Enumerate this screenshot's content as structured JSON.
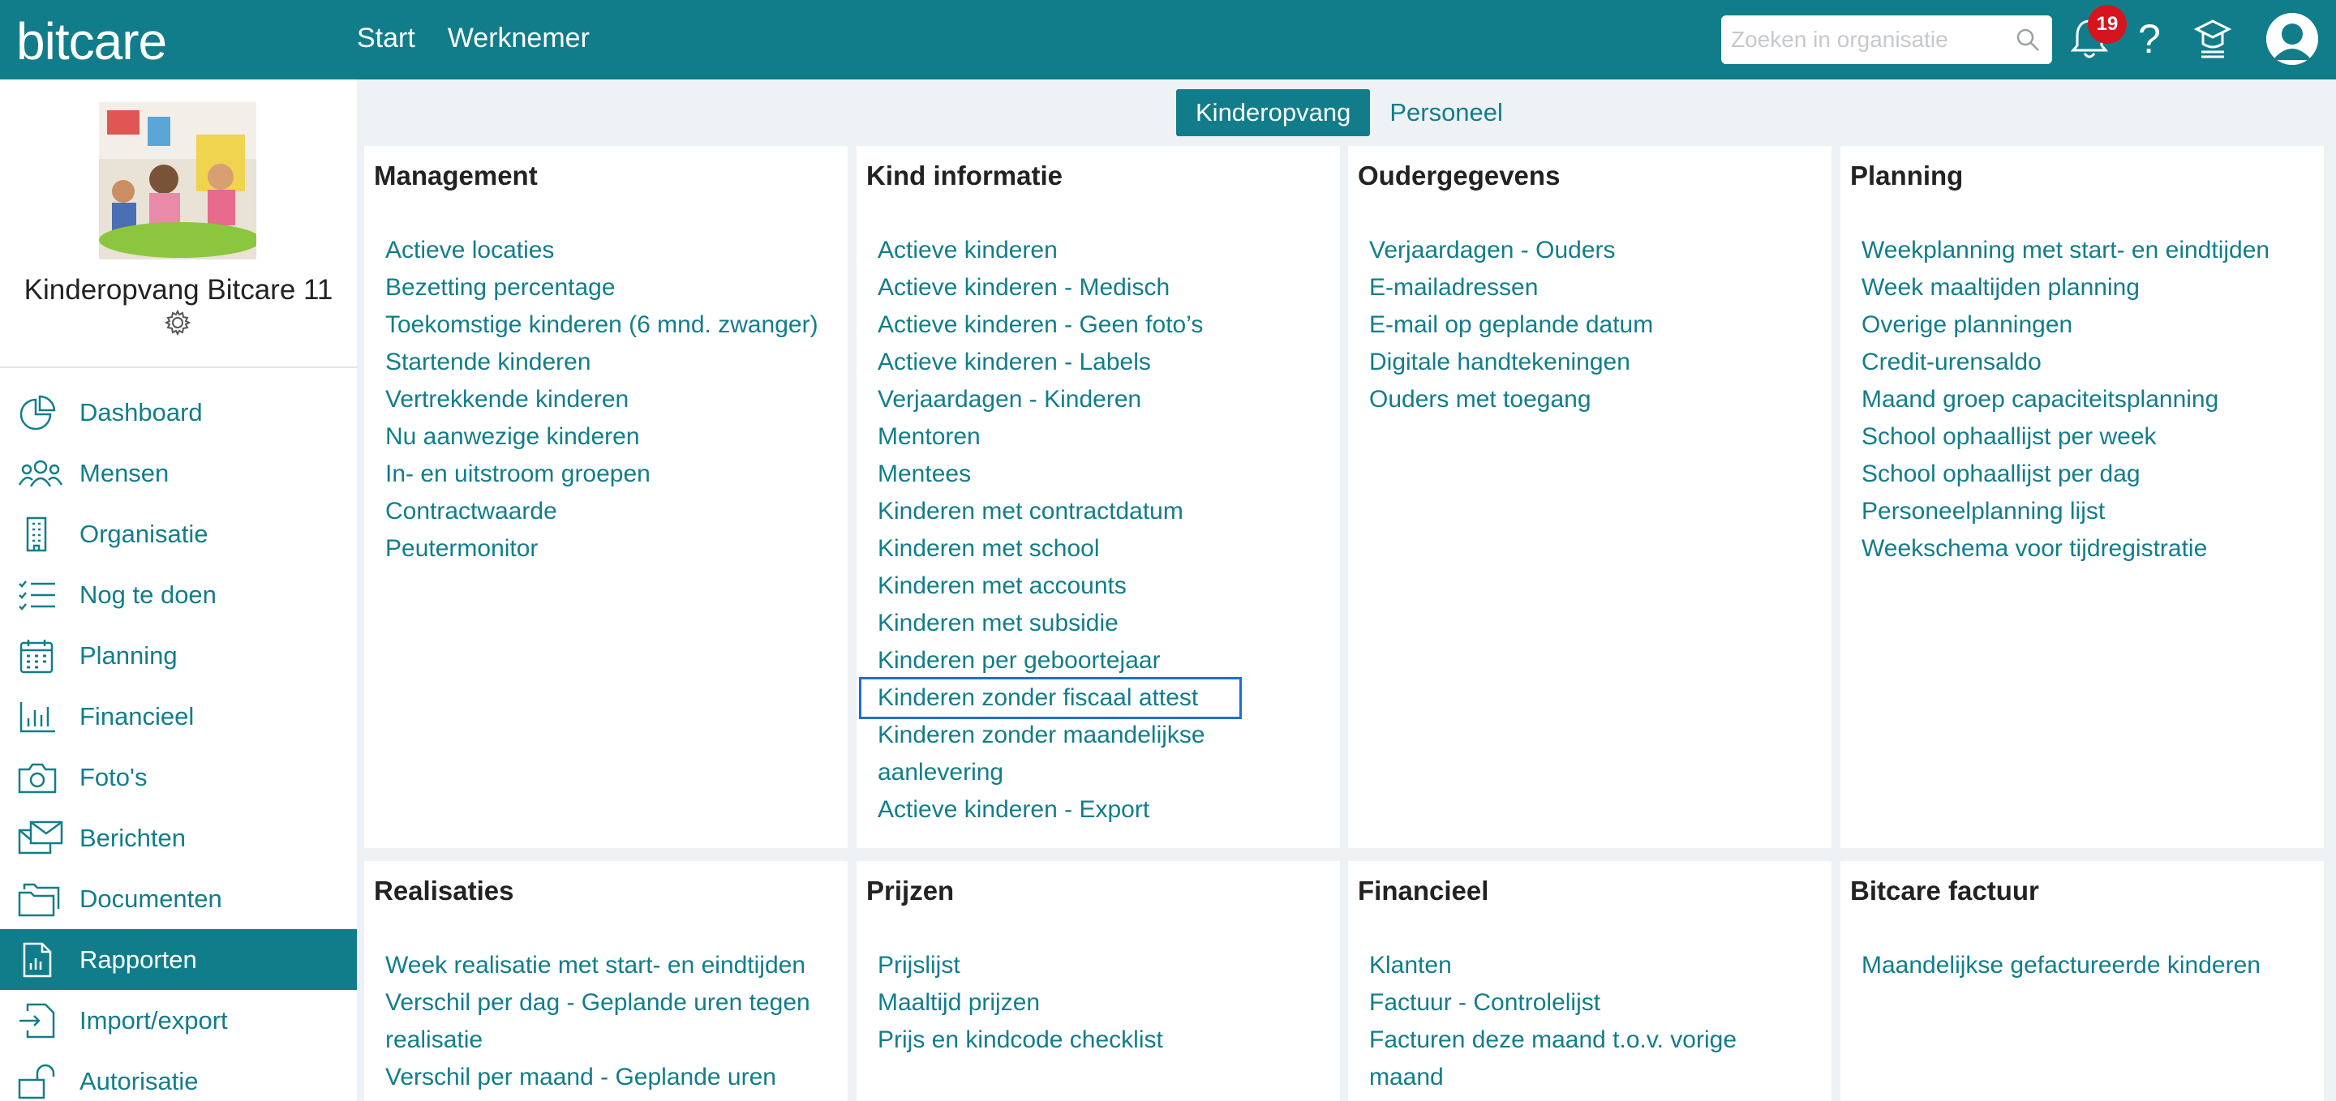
{
  "app": {
    "logo": "bitcare"
  },
  "topnav": {
    "start": "Start",
    "werknemer": "Werknemer"
  },
  "search": {
    "placeholder": "Zoeken in organisatie"
  },
  "notifications": {
    "count": "19"
  },
  "help": {
    "label": "?"
  },
  "sidebar": {
    "org_name": "Kinderopvang Bitcare 11",
    "items": [
      {
        "label": "Dashboard",
        "icon": "pie-chart-icon"
      },
      {
        "label": "Mensen",
        "icon": "people-icon"
      },
      {
        "label": "Organisatie",
        "icon": "building-icon"
      },
      {
        "label": "Nog te doen",
        "icon": "checklist-icon"
      },
      {
        "label": "Planning",
        "icon": "calendar-icon"
      },
      {
        "label": "Financieel",
        "icon": "bar-chart-icon"
      },
      {
        "label": "Foto's",
        "icon": "camera-icon"
      },
      {
        "label": "Berichten",
        "icon": "messages-icon"
      },
      {
        "label": "Documenten",
        "icon": "folder-icon"
      },
      {
        "label": "Rapporten",
        "icon": "report-icon",
        "active": true
      },
      {
        "label": "Import/export",
        "icon": "import-export-icon"
      },
      {
        "label": "Autorisatie",
        "icon": "lock-icon"
      }
    ]
  },
  "tabs": {
    "kinderopvang": "Kinderopvang",
    "personeel": "Personeel"
  },
  "cards": {
    "management": {
      "title": "Management",
      "links": [
        "Actieve locaties",
        "Bezetting percentage",
        "Toekomstige kinderen (6 mnd. zwanger)",
        "Startende kinderen",
        "Vertrekkende kinderen",
        "Nu aanwezige kinderen",
        "In- en uitstroom groepen",
        "Contractwaarde",
        "Peutermonitor"
      ]
    },
    "kind_informatie": {
      "title": "Kind informatie",
      "links": [
        "Actieve kinderen",
        "Actieve kinderen - Medisch",
        "Actieve kinderen - Geen foto’s",
        "Actieve kinderen - Labels",
        "Verjaardagen - Kinderen",
        "Mentoren",
        "Mentees",
        "Kinderen met contractdatum",
        "Kinderen met school",
        "Kinderen met accounts",
        "Kinderen met subsidie",
        "Kinderen per geboortejaar",
        "Kinderen zonder fiscaal attest",
        "Kinderen zonder maandelijkse aanlevering",
        "Actieve kinderen - Export"
      ]
    },
    "oudergegevens": {
      "title": "Oudergegevens",
      "links": [
        "Verjaardagen - Ouders",
        "E-mailadressen",
        "E-mail op geplande datum",
        "Digitale handtekeningen",
        "Ouders met toegang"
      ]
    },
    "planning": {
      "title": "Planning",
      "links": [
        "Weekplanning met start- en eindtijden",
        "Week maaltijden planning",
        "Overige planningen",
        "Credit-urensaldo",
        "Maand groep capaciteitsplanning",
        "School ophaallijst per week",
        "School ophaallijst per dag",
        "Personeelplanning lijst",
        "Weekschema voor tijdregistratie"
      ]
    },
    "realisaties": {
      "title": "Realisaties",
      "links": [
        "Week realisatie met start- en eindtijden",
        "Verschil per dag - Geplande uren tegen realisatie",
        "Verschil per maand - Geplande uren"
      ]
    },
    "prijzen": {
      "title": "Prijzen",
      "links": [
        "Prijslijst",
        "Maaltijd prijzen",
        "Prijs en kindcode checklist"
      ]
    },
    "financieel": {
      "title": "Financieel",
      "links": [
        "Klanten",
        "Factuur - Controlelijst",
        "Facturen deze maand t.o.v. vorige maand"
      ]
    },
    "bitcare_factuur": {
      "title": "Bitcare factuur",
      "links": [
        "Maandelijkse gefactureerde kinderen"
      ]
    }
  }
}
